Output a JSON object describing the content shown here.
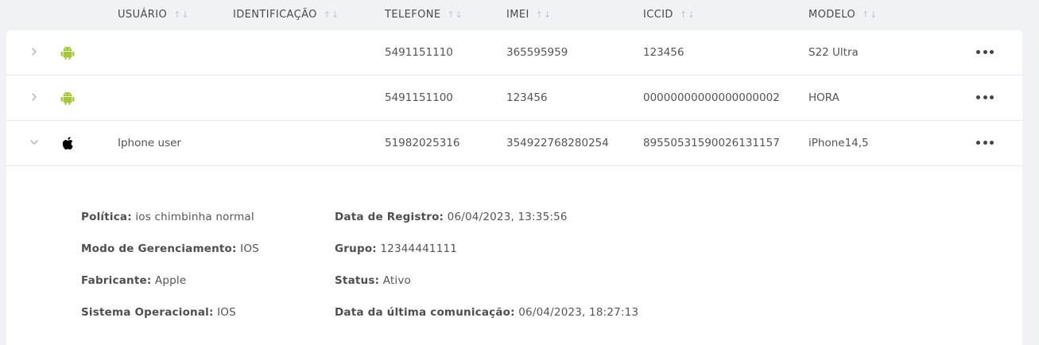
{
  "columns": [
    {
      "key": "usuario",
      "label": "USUÁRIO"
    },
    {
      "key": "identificacao",
      "label": "IDENTIFICAÇÃO"
    },
    {
      "key": "telefone",
      "label": "TELEFONE"
    },
    {
      "key": "imei",
      "label": "IMEI"
    },
    {
      "key": "iccid",
      "label": "ICCID"
    },
    {
      "key": "modelo",
      "label": "MODELO"
    }
  ],
  "sort_glyph": "↑↓",
  "rows": [
    {
      "os": "android-icon",
      "usuario": "",
      "identificacao": "",
      "telefone": "5491151110",
      "imei": "365595959",
      "iccid": "123456",
      "modelo": "S22 Ultra",
      "expanded": false
    },
    {
      "os": "android-icon",
      "usuario": "",
      "identificacao": "",
      "telefone": "5491151100",
      "imei": "123456",
      "iccid": "00000000000000000002",
      "modelo": "HORA",
      "expanded": false
    },
    {
      "os": "apple-icon",
      "usuario": "Iphone user",
      "identificacao": "",
      "telefone": "51982025316",
      "imei": "354922768280254",
      "iccid": "89550531590026131157",
      "modelo": "iPhone14,5",
      "expanded": true
    }
  ],
  "details": {
    "politica": {
      "label": "Política:",
      "value": "ios chimbinha normal"
    },
    "modo": {
      "label": "Modo de Gerenciamento:",
      "value": "IOS"
    },
    "fabricante": {
      "label": "Fabricante:",
      "value": "Apple"
    },
    "sistema": {
      "label": "Sistema Operacional:",
      "value": "IOS"
    },
    "registro": {
      "label": "Data de Registro:",
      "value": "06/04/2023, 13:35:56"
    },
    "grupo": {
      "label": "Grupo:",
      "value": "12344441111"
    },
    "status": {
      "label": "Status:",
      "value": "Ativo"
    },
    "ultima": {
      "label": "Data da última comunicação:",
      "value": "06/04/2023, 18:27:13"
    }
  },
  "colors": {
    "android": "#a4c639",
    "apple": "#000000",
    "chevron": "#b9bcc4",
    "background": "#f1f2f6"
  }
}
